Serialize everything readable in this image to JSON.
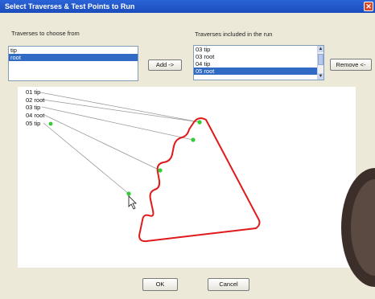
{
  "dialog": {
    "title": "Select Traverses & Test Points to Run",
    "close_glyph": "✕"
  },
  "left_list": {
    "label": "Traverses to choose from",
    "items": [
      {
        "text": "tip",
        "selected": false
      },
      {
        "text": "root",
        "selected": true
      }
    ]
  },
  "right_list": {
    "label": "Traverses included in the run",
    "items": [
      {
        "text": "03 tip",
        "selected": false
      },
      {
        "text": "03 root",
        "selected": false
      },
      {
        "text": "04 tip",
        "selected": false
      },
      {
        "text": "05 root",
        "selected": true
      }
    ]
  },
  "buttons": {
    "add": "Add ->",
    "remove": "Remove <-",
    "ok": "OK",
    "cancel": "Cancel"
  },
  "points": [
    {
      "label": "01 tip"
    },
    {
      "label": "02 root"
    },
    {
      "label": "03 tip"
    },
    {
      "label": "04 root"
    },
    {
      "label": "05 tip"
    }
  ],
  "colors": {
    "profile": "#e01a1a",
    "point_marker": "#33cc33",
    "leader_line": "#9a9a9a",
    "selection": "#316ac5",
    "title_bar": "#1f55c8"
  }
}
